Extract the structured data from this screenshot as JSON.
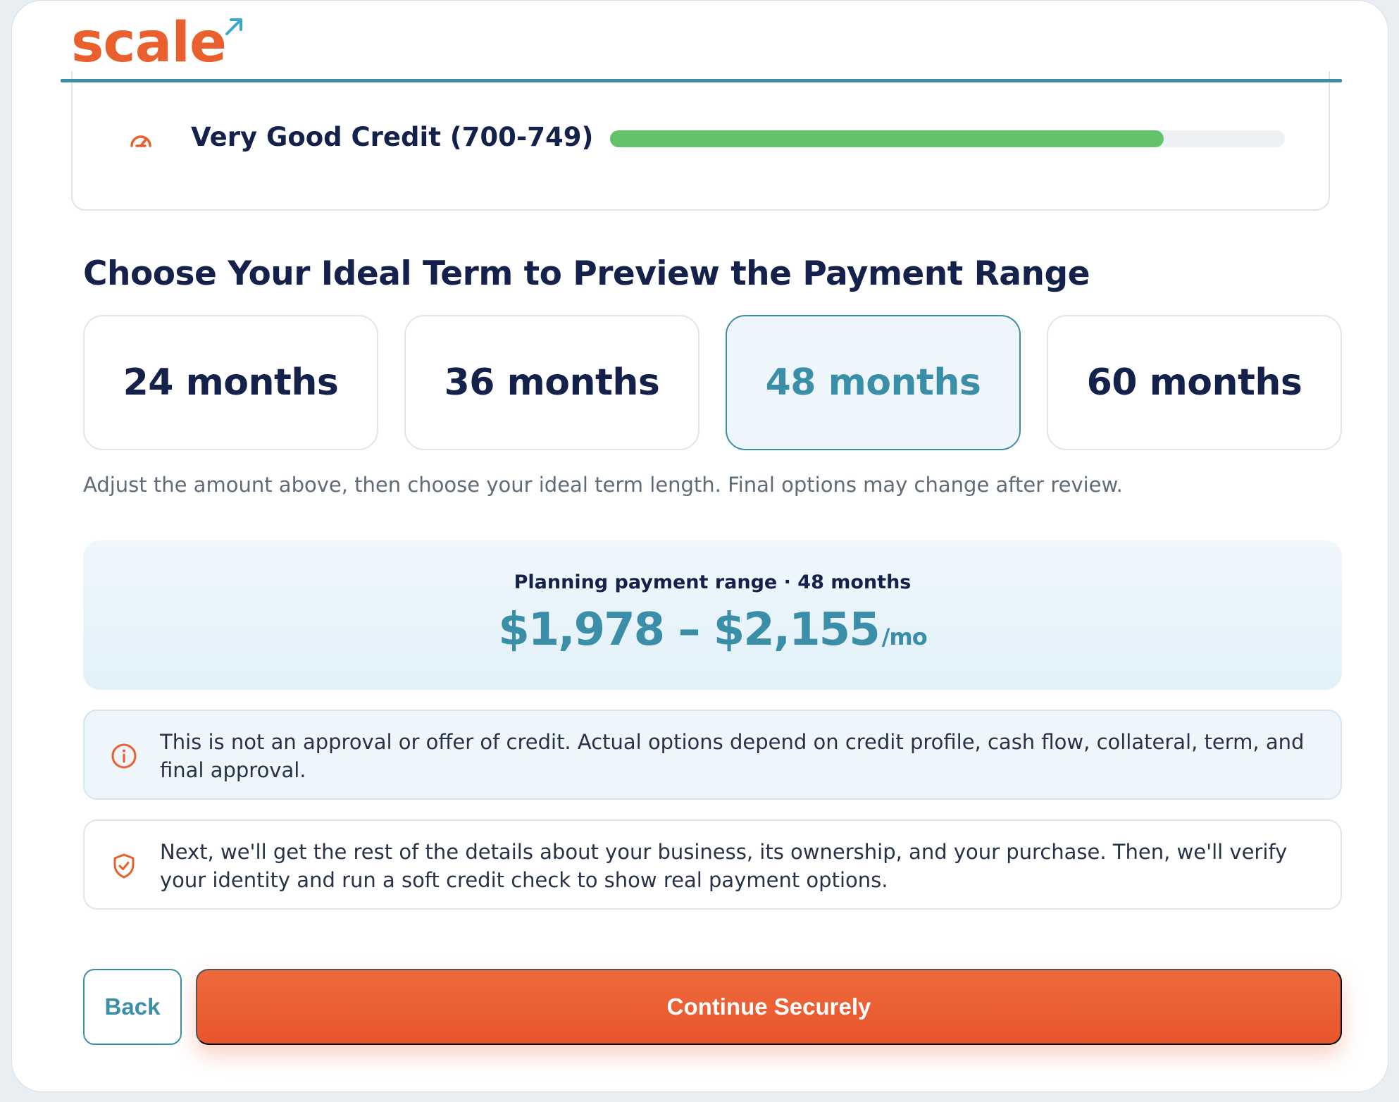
{
  "brand": {
    "logo_text": "scale",
    "logo_color": "#ea5f2e",
    "arrow_color": "#3ba6c9"
  },
  "credit": {
    "label": "Very Good Credit (700-749)",
    "icon": "gauge-icon",
    "bar_fill_fraction": 0.82,
    "bar_color": "#62c36b"
  },
  "terms_section": {
    "title": "Choose Your Ideal Term to Preview the Payment Range",
    "options": [
      {
        "label": "24 months",
        "selected": false
      },
      {
        "label": "36 months",
        "selected": false
      },
      {
        "label": "48 months",
        "selected": true
      },
      {
        "label": "60 months",
        "selected": false
      }
    ],
    "hint": "Adjust the amount above, then choose your ideal term length. Final options may change after review."
  },
  "range": {
    "caption": "Planning payment range · 48 months",
    "amount": "$1,978 – $2,155",
    "unit": "/mo"
  },
  "notice": {
    "icon": "info-icon",
    "text": "This is not an approval or offer of credit. Actual options depend on credit profile, cash flow, collateral, term, and final approval."
  },
  "next_steps": {
    "icon": "shield-check-icon",
    "text": "Next, we'll get the rest of the details about your business, its ownership, and your purchase. Then, we'll verify your identity and run a soft credit check to show real payment options."
  },
  "actions": {
    "back_label": "Back",
    "continue_label": "Continue Securely"
  },
  "colors": {
    "navy": "#14214a",
    "teal": "#3b8ea8",
    "orange": "#e8552c"
  }
}
